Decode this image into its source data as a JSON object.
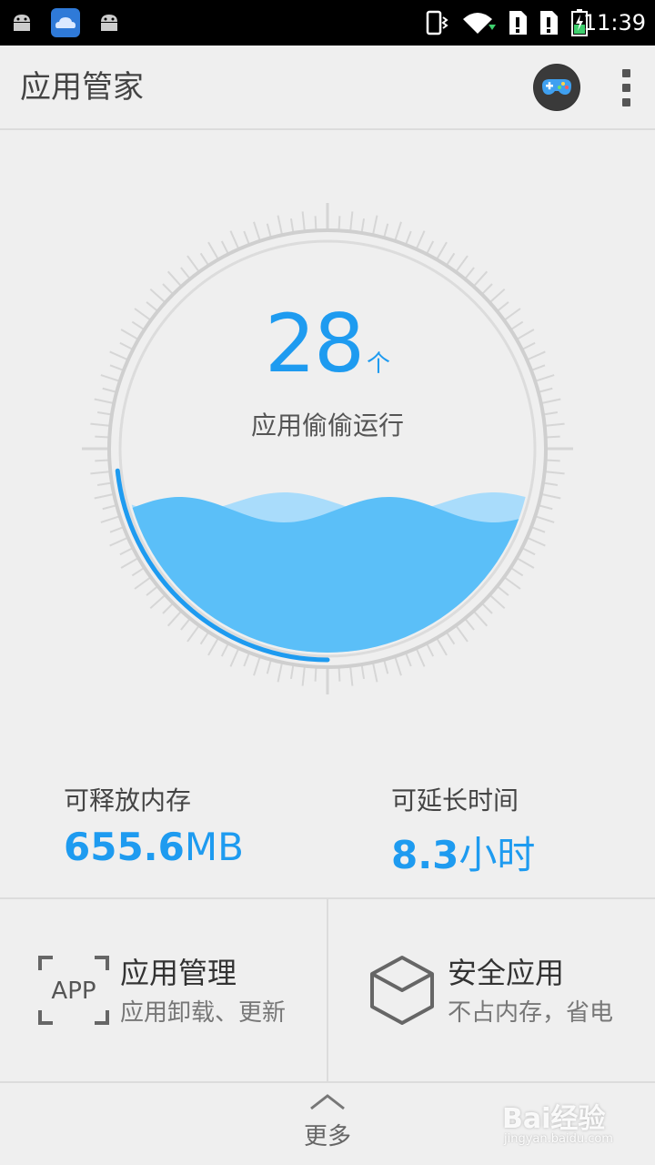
{
  "status_bar": {
    "time": "11:39",
    "left_icons": [
      "android-icon",
      "weather-cloud-icon",
      "android-icon"
    ],
    "right_icons": [
      "vibrate-icon",
      "wifi-icon",
      "sim-alert-icon",
      "sim-alert-icon",
      "battery-charging-icon"
    ]
  },
  "app_bar": {
    "title": "应用管家",
    "game_icon": "gamepad-icon",
    "menu_icon": "overflow-menu-icon"
  },
  "gauge": {
    "count": "28",
    "count_unit": "个",
    "label": "应用偷偷运行",
    "accent_color": "#1e9bf0",
    "water_color": "#5bbff8"
  },
  "stats": {
    "memory": {
      "label": "可释放内存",
      "value": "655.6",
      "unit": "MB"
    },
    "time": {
      "label": "可延长时间",
      "value": "8.3",
      "unit": "小时"
    }
  },
  "cards": {
    "app_manage": {
      "title": "应用管理",
      "subtitle": "应用卸载、更新",
      "icon_text": "APP"
    },
    "safe_apps": {
      "title": "安全应用",
      "subtitle": "不占内存，省电"
    }
  },
  "more": {
    "label": "更多"
  },
  "watermark": {
    "text": "Bai经验",
    "sub": "jingyan.baidu.com"
  }
}
